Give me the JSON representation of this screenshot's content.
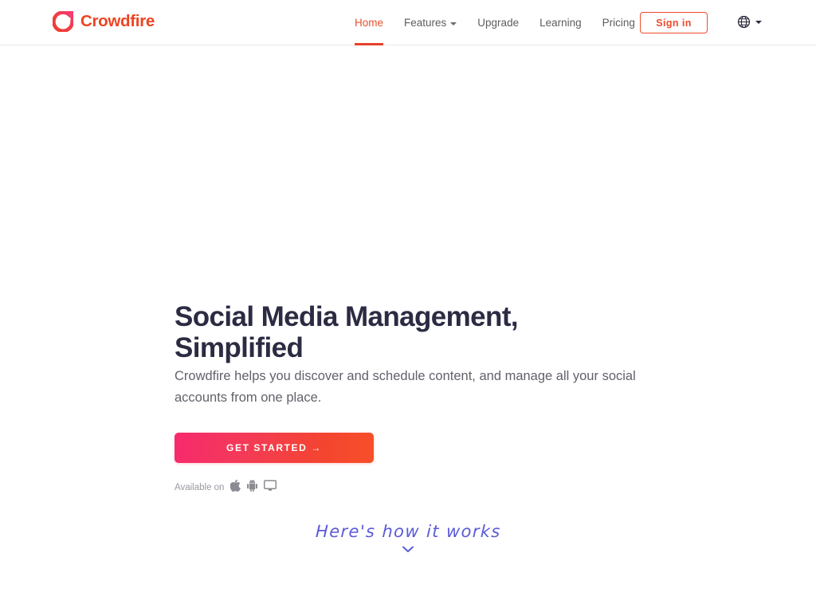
{
  "header": {
    "brand": {
      "name": "Crowdfire",
      "logo_icon": "crowdfire-ring-logo",
      "color": "#ee4422"
    },
    "nav": [
      {
        "label": "Home",
        "active": true,
        "has_dropdown": false
      },
      {
        "label": "Features",
        "active": false,
        "has_dropdown": true
      },
      {
        "label": "Upgrade",
        "active": false,
        "has_dropdown": false
      },
      {
        "label": "Learning",
        "active": false,
        "has_dropdown": false
      },
      {
        "label": "Pricing",
        "active": false,
        "has_dropdown": false
      }
    ],
    "signin_label": "Sign in",
    "language_icon": "globe-icon",
    "active_color": "#e8522e",
    "border_color": "#e9e9ea"
  },
  "hero": {
    "headline_line1": "Social Media Management,",
    "headline_line2": "Simplified",
    "headline": "Social Media Management, Simplified",
    "subheading": "Crowdfire helps you discover and schedule content, and manage all your social accounts from one place.",
    "cta_label": "GET STARTED →",
    "cta_gradient_from": "#f62a6e",
    "cta_gradient_to": "#f7502a",
    "headline_color": "#2b2b43",
    "available": {
      "label": "Available on",
      "platforms": [
        "apple-icon",
        "android-icon",
        "desktop-icon"
      ]
    },
    "scroll_hint": {
      "text": "Here's how it works",
      "color": "#5b5bd8",
      "chevron_icon": "chevron-down-icon"
    }
  }
}
